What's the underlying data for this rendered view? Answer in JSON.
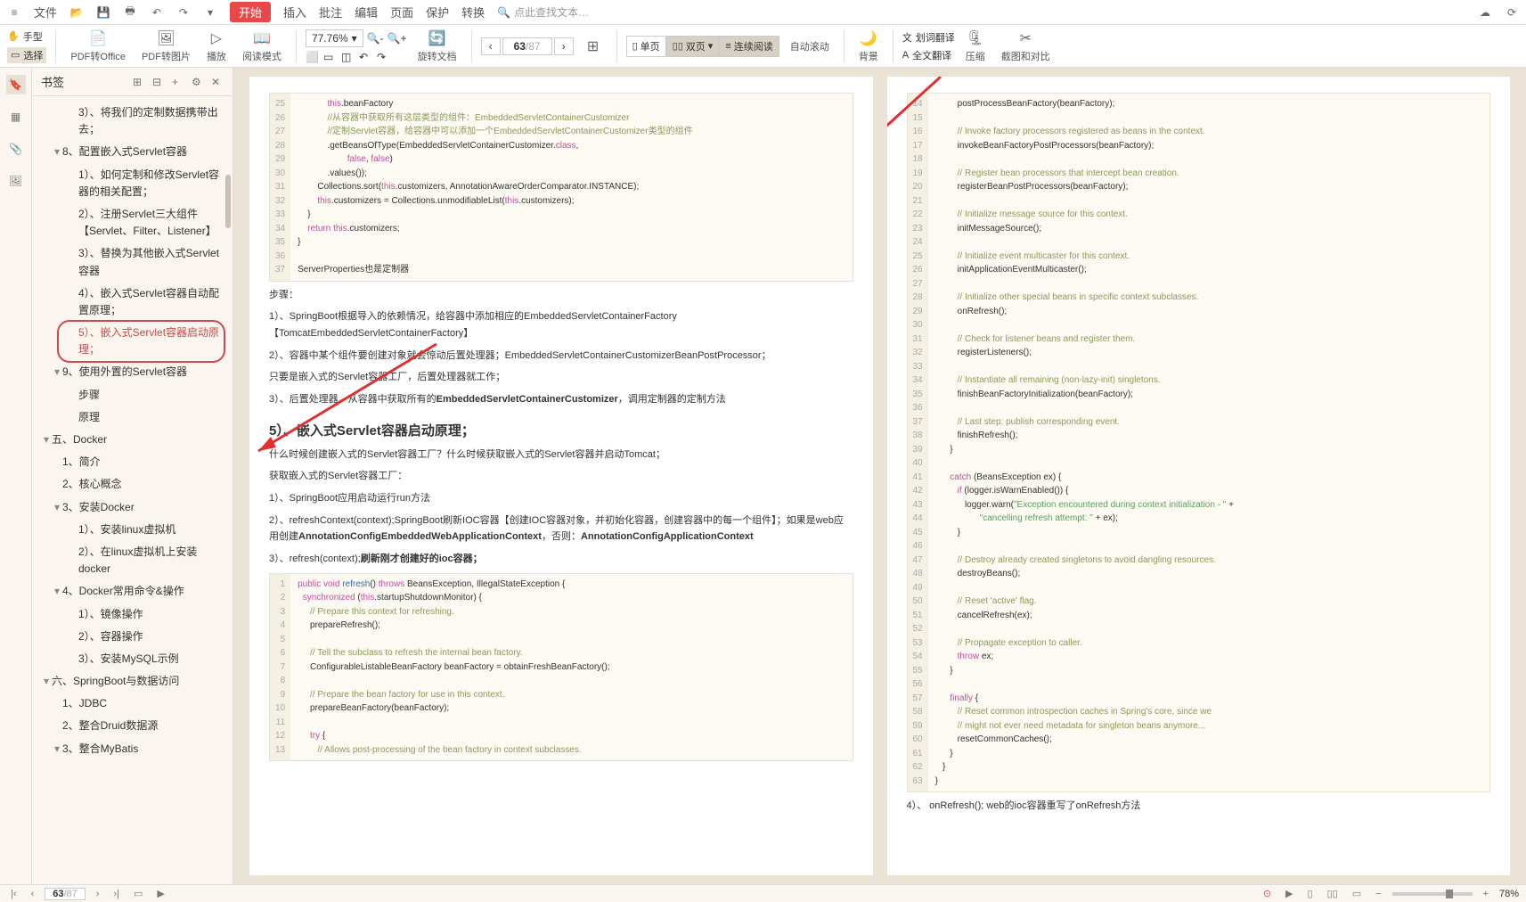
{
  "menubar": {
    "file": "文件",
    "tabs": [
      "开始",
      "插入",
      "批注",
      "编辑",
      "页面",
      "保护",
      "转换"
    ],
    "search_placeholder": "点此查找文本…"
  },
  "ribbon": {
    "hand": "手型",
    "select": "选择",
    "pdf_office": "PDF转Office",
    "pdf_img": "PDF转图片",
    "play": "播放",
    "read_mode": "阅读模式",
    "zoom": "77.76%",
    "rotate": "旋转文档",
    "page_cur": "63",
    "page_total": "/87",
    "single": "单页",
    "double": "双页",
    "continuous": "连续阅读",
    "autoscroll": "自动滚动",
    "background": "背景",
    "sel_trans": "划词翻译",
    "full_trans": "全文翻译",
    "compress": "压缩",
    "crop_compare": "截图和对比"
  },
  "bookmarks": {
    "title": "书签",
    "items": [
      {
        "lvl": 2,
        "txt": "3）、将我们的定制数据携带出去；"
      },
      {
        "lvl": 1,
        "txt": "8、配置嵌入式Servlet容器",
        "tog": "▾"
      },
      {
        "lvl": 2,
        "txt": "1）、如何定制和修改Servlet容器的相关配置；"
      },
      {
        "lvl": 2,
        "txt": "2）、注册Servlet三大组件【Servlet、Filter、Listener】"
      },
      {
        "lvl": 2,
        "txt": "3）、替换为其他嵌入式Servlet容器"
      },
      {
        "lvl": 2,
        "txt": "4）、嵌入式Servlet容器自动配置原理；"
      },
      {
        "lvl": 2,
        "txt": "5）、嵌入式Servlet容器启动原理；",
        "sel": true
      },
      {
        "lvl": 1,
        "txt": "9、使用外置的Servlet容器",
        "tog": "▾"
      },
      {
        "lvl": 2,
        "txt": "步骤"
      },
      {
        "lvl": 2,
        "txt": "原理"
      },
      {
        "lvl": 0,
        "txt": "五、Docker",
        "tog": "▾"
      },
      {
        "lvl": 1,
        "txt": "1、简介"
      },
      {
        "lvl": 1,
        "txt": "2、核心概念"
      },
      {
        "lvl": 1,
        "txt": "3、安装Docker",
        "tog": "▾"
      },
      {
        "lvl": 2,
        "txt": "1）、安装linux虚拟机"
      },
      {
        "lvl": 2,
        "txt": "2）、在linux虚拟机上安装docker"
      },
      {
        "lvl": 1,
        "txt": "4、Docker常用命令&操作",
        "tog": "▾"
      },
      {
        "lvl": 2,
        "txt": "1）、镜像操作"
      },
      {
        "lvl": 2,
        "txt": "2）、容器操作"
      },
      {
        "lvl": 2,
        "txt": "3）、安装MySQL示例"
      },
      {
        "lvl": 0,
        "txt": "六、SpringBoot与数据访问",
        "tog": "▾"
      },
      {
        "lvl": 1,
        "txt": "1、JDBC"
      },
      {
        "lvl": 1,
        "txt": "2、整合Druid数据源"
      },
      {
        "lvl": 1,
        "txt": "3、整合MyBatis",
        "tog": "▾"
      }
    ]
  },
  "pageL": {
    "code1": {
      "start": 25,
      "lines": [
        "            <span class='kw'>this</span>.beanFactory",
        "            <span class='cm'>//从容器中获取所有这层类型的组件：EmbeddedServletContainerCustomizer</span>",
        "            <span class='cm'>//定制Servlet容器，给容器中可以添加一个EmbeddedServletContainerCustomizer类型的组件</span>",
        "            .getBeansOfType(EmbeddedServletContainerCustomizer.<span class='kw'>class</span>,",
        "                    <span class='kw'>false</span>, <span class='kw'>false</span>)",
        "            .values());",
        "        Collections.sort(<span class='kw'>this</span>.customizers, AnnotationAwareOrderComparator.INSTANCE);",
        "        <span class='kw'>this</span>.customizers = Collections.unmodifiableList(<span class='kw'>this</span>.customizers);",
        "    }",
        "    <span class='kw'>return this</span>.customizers;",
        "}",
        "",
        "ServerProperties也是定制器"
      ]
    },
    "steps_title": "步骤：",
    "step1": "1）、SpringBoot根据导入的依赖情况，给容器中添加相应的EmbeddedServletContainerFactory【TomcatEmbeddedServletContainerFactory】",
    "step2": "2）、容器中某个组件要创建对象就会惊动后置处理器；EmbeddedServletContainerCustomizerBeanPostProcessor；",
    "step2b": "只要是嵌入式的Servlet容器工厂，后置处理器就工作；",
    "step3": "3）、后置处理器，从容器中获取所有的<b>EmbeddedServletContainerCustomizer</b>，调用定制器的定制方法",
    "h3": "5）、嵌入式Servlet容器启动原理；",
    "q": "什么时候创建嵌入式的Servlet容器工厂？什么时候获取嵌入式的Servlet容器并启动Tomcat；",
    "get": "获取嵌入式的Servlet容器工厂：",
    "g1": "1）、SpringBoot应用启动运行run方法",
    "g2": "2）、refreshContext(context);SpringBoot刷新IOC容器【创建IOC容器对象，并初始化容器，创建容器中的每一个组件】；如果是web应用创建<b>AnnotationConfigEmbeddedWebApplicationContext</b>，否则：<b>AnnotationConfigApplicationContext</b>",
    "g3": "3）、refresh(context);<b>刷新刚才创建好的ioc容器；</b>",
    "code2": {
      "start": 1,
      "lines": [
        "<span class='kw'>public</span> <span class='kw'>void</span> <span class='fn'>refresh</span>() <span class='kw'>throws</span> BeansException, IllegalStateException {",
        "  <span class='kw'>synchronized</span> (<span class='kw'>this</span>.startupShutdownMonitor) {",
        "     <span class='cm'>// Prepare this context for refreshing.</span>",
        "     prepareRefresh();",
        "",
        "     <span class='cm'>// Tell the subclass to refresh the internal bean factory.</span>",
        "     ConfigurableListableBeanFactory beanFactory = obtainFreshBeanFactory();",
        "",
        "     <span class='cm'>// Prepare the bean factory for use in this context.</span>",
        "     prepareBeanFactory(beanFactory);",
        "",
        "     <span class='kw'>try</span> {",
        "        <span class='cm'>// Allows post-processing of the bean factory in context subclasses.</span>"
      ]
    }
  },
  "pageR": {
    "code": {
      "start": 14,
      "lines": [
        "         postProcessBeanFactory(beanFactory);",
        "",
        "         <span class='cm'>// Invoke factory processors registered as beans in the context.</span>",
        "         invokeBeanFactoryPostProcessors(beanFactory);",
        "",
        "         <span class='cm'>// Register bean processors that intercept bean creation.</span>",
        "         registerBeanPostProcessors(beanFactory);",
        "",
        "         <span class='cm'>// Initialize message source for this context.</span>",
        "         initMessageSource();",
        "",
        "         <span class='cm'>// Initialize event multicaster for this context.</span>",
        "         initApplicationEventMulticaster();",
        "",
        "         <span class='cm'>// Initialize other special beans in specific context subclasses.</span>",
        "         onRefresh();",
        "",
        "         <span class='cm'>// Check for listener beans and register them.</span>",
        "         registerListeners();",
        "",
        "         <span class='cm'>// Instantiate all remaining (non-lazy-init) singletons.</span>",
        "         finishBeanFactoryInitialization(beanFactory);",
        "",
        "         <span class='cm'>// Last step: publish corresponding event.</span>",
        "         finishRefresh();",
        "      }",
        "",
        "      <span class='kw'>catch</span> (BeansException ex) {",
        "         <span class='kw'>if</span> (logger.isWarnEnabled()) {",
        "            logger.warn(<span class='str'>\"Exception encountered during context initialization - \"</span> +",
        "                  <span class='str'>\"cancelling refresh attempt: \"</span> + ex);",
        "         }",
        "",
        "         <span class='cm'>// Destroy already created singletons to avoid dangling resources.</span>",
        "         destroyBeans();",
        "",
        "         <span class='cm'>// Reset 'active' flag.</span>",
        "         cancelRefresh(ex);",
        "",
        "         <span class='cm'>// Propagate exception to caller.</span>",
        "         <span class='kw'>throw</span> ex;",
        "      }",
        "",
        "      <span class='kw'>finally</span> {",
        "         <span class='cm'>// Reset common introspection caches in Spring's core, since we</span>",
        "         <span class='cm'>// might not ever need metadata for singleton beans anymore...</span>",
        "         resetCommonCaches();",
        "      }",
        "   }",
        "}"
      ]
    },
    "onrefresh": "4）、 onRefresh(); web的ioc容器重写了onRefresh方法"
  },
  "statusbar": {
    "page_cur": "63",
    "page_total": "/87",
    "zoom": "78%"
  }
}
